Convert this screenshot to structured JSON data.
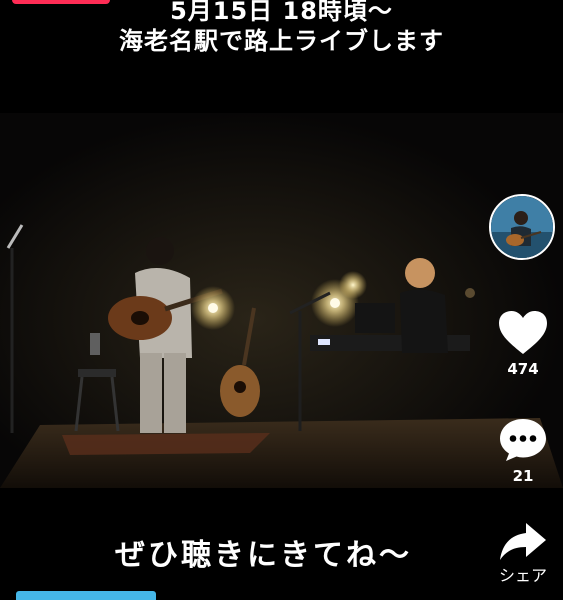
{
  "caption": {
    "line1": "5月15日 18時頃〜",
    "line2": "海老名駅で路上ライブします",
    "bottom": "ぜひ聴きにきてね〜"
  },
  "actions": {
    "likes": "474",
    "comments": "21",
    "share_label": "シェア"
  },
  "icons": {
    "like": "heart-icon",
    "comment": "comment-bubble-icon",
    "share": "share-arrow-icon"
  },
  "colors": {
    "live_badge": "#fe2c55",
    "tag_chip": "#45b7e8",
    "icon": "#ffffff",
    "background": "#000000"
  }
}
